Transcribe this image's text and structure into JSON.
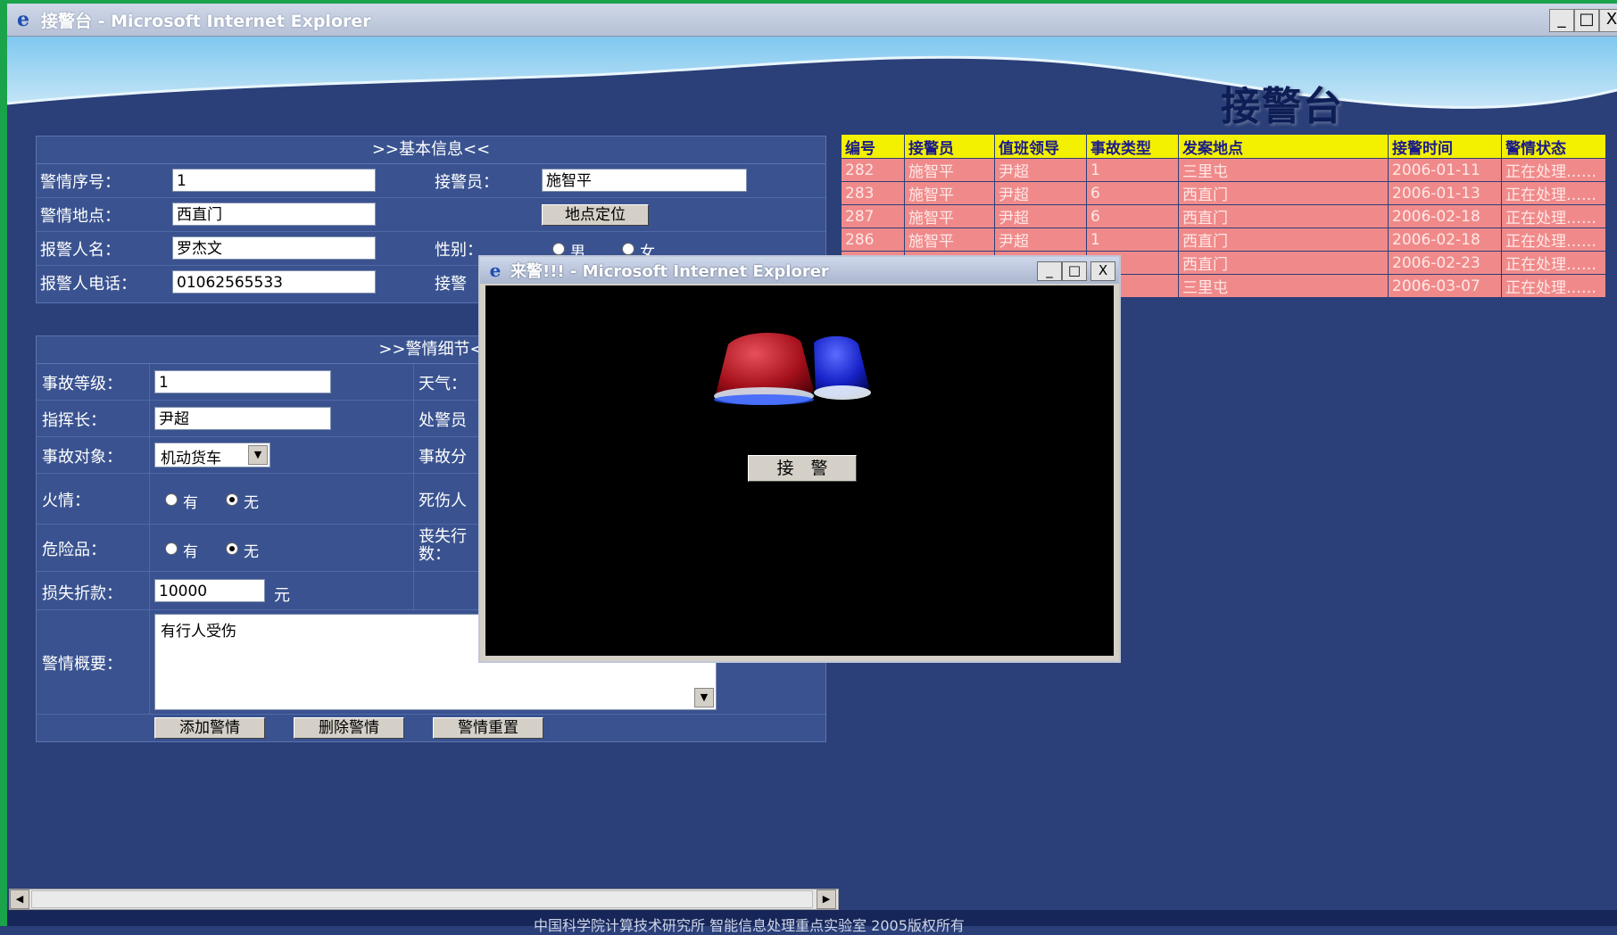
{
  "window": {
    "title": "接警台 - Microsoft Internet Explorer",
    "controls": {
      "minimize": "_",
      "maximize": "□",
      "close": "X"
    }
  },
  "page_title": "接警台",
  "basic": {
    "header": ">>基本信息<<",
    "serial_label": "警情序号：",
    "serial_value": "1",
    "operator_label": "接警员：",
    "operator_value": "施智平",
    "location_label": "警情地点：",
    "location_value": "西直门",
    "locate_button": "地点定位",
    "reporter_label": "报警人名：",
    "reporter_value": "罗杰文",
    "gender_label": "性别：",
    "gender_male": "男",
    "gender_female": "女",
    "phone_label": "报警人电话：",
    "phone_value": "01062565533",
    "receive_partial_label": "接警"
  },
  "detail": {
    "header": ">>警情细节<",
    "level_label": "事故等级：",
    "level_value": "1",
    "weather_label": "天气：",
    "commander_label": "指挥长：",
    "commander_value": "尹超",
    "handler_label": "处警员",
    "object_label": "事故对象：",
    "object_value": "机动货车",
    "category_label": "事故分",
    "fire_label": "火情：",
    "yes": "有",
    "no": "无",
    "casualty_label": "死伤人",
    "hazard_label": "危险品：",
    "lost_label": "丧失行\n数：",
    "loss_label": "损失折款：",
    "loss_value": "10000",
    "loss_unit": "元",
    "summary_label": "警情概要：",
    "summary_value": "有行人受伤",
    "add_button": "添加警情",
    "delete_button": "删除警情",
    "reset_button": "警情重置"
  },
  "alerts_table": {
    "headers": [
      "编号",
      "接警员",
      "值班领导",
      "事故类型",
      "发案地点",
      "接警时间",
      "警情状态"
    ],
    "rows": [
      [
        "282",
        "施智平",
        "尹超",
        "1",
        "三里屯",
        "2006-01-11",
        "正在处理……"
      ],
      [
        "283",
        "施智平",
        "尹超",
        "6",
        "西直门",
        "2006-01-13",
        "正在处理……"
      ],
      [
        "287",
        "施智平",
        "尹超",
        "6",
        "西直门",
        "2006-02-18",
        "正在处理……"
      ],
      [
        "286",
        "施智平",
        "尹超",
        "1",
        "西直门",
        "2006-02-18",
        "正在处理……"
      ],
      [
        "",
        "",
        "",
        "",
        "西直门",
        "2006-02-23",
        "正在处理……"
      ],
      [
        "",
        "",
        "",
        "",
        "三里屯",
        "2006-03-07",
        "正在处理……"
      ]
    ]
  },
  "popup": {
    "title": "来警!!! - Microsoft Internet Explorer",
    "accept_button": "接　警"
  },
  "footer": {
    "text": "中国科学院计算技术研究所 智能信息处理重点实验室 2005版权所有"
  }
}
